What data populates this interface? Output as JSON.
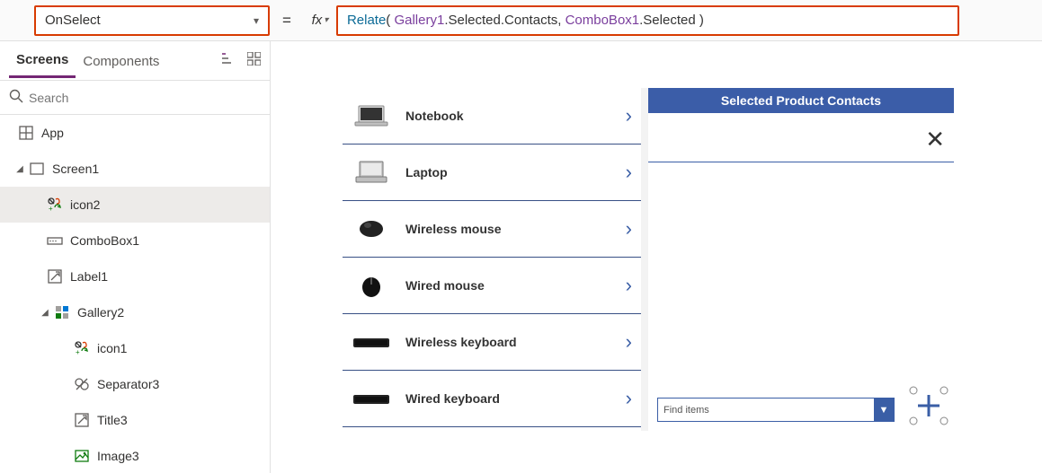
{
  "property_selector": {
    "value": "OnSelect"
  },
  "formula": {
    "tokens": [
      {
        "t": "fn",
        "v": "Relate"
      },
      {
        "t": "plain",
        "v": "( "
      },
      {
        "t": "ctrl",
        "v": "Gallery1"
      },
      {
        "t": "plain",
        "v": ".Selected.Contacts, "
      },
      {
        "t": "ctrl",
        "v": "ComboBox1"
      },
      {
        "t": "plain",
        "v": ".Selected )"
      }
    ]
  },
  "tabs": {
    "screens": "Screens",
    "components": "Components"
  },
  "search": {
    "placeholder": "Search"
  },
  "tree": {
    "app": "App",
    "screen1": "Screen1",
    "icon2": "icon2",
    "combobox1": "ComboBox1",
    "label1": "Label1",
    "gallery2": "Gallery2",
    "icon1": "icon1",
    "separator3": "Separator3",
    "title3": "Title3",
    "image3": "Image3"
  },
  "gallery_items": [
    {
      "label": "Notebook",
      "shape": "laptop1"
    },
    {
      "label": "Laptop",
      "shape": "laptop2"
    },
    {
      "label": "Wireless mouse",
      "shape": "mouse1"
    },
    {
      "label": "Wired mouse",
      "shape": "mouse2"
    },
    {
      "label": "Wireless keyboard",
      "shape": "kb"
    },
    {
      "label": "Wired keyboard",
      "shape": "kb"
    }
  ],
  "contacts_panel": {
    "header": "Selected Product Contacts",
    "combo_placeholder": "Find items"
  }
}
